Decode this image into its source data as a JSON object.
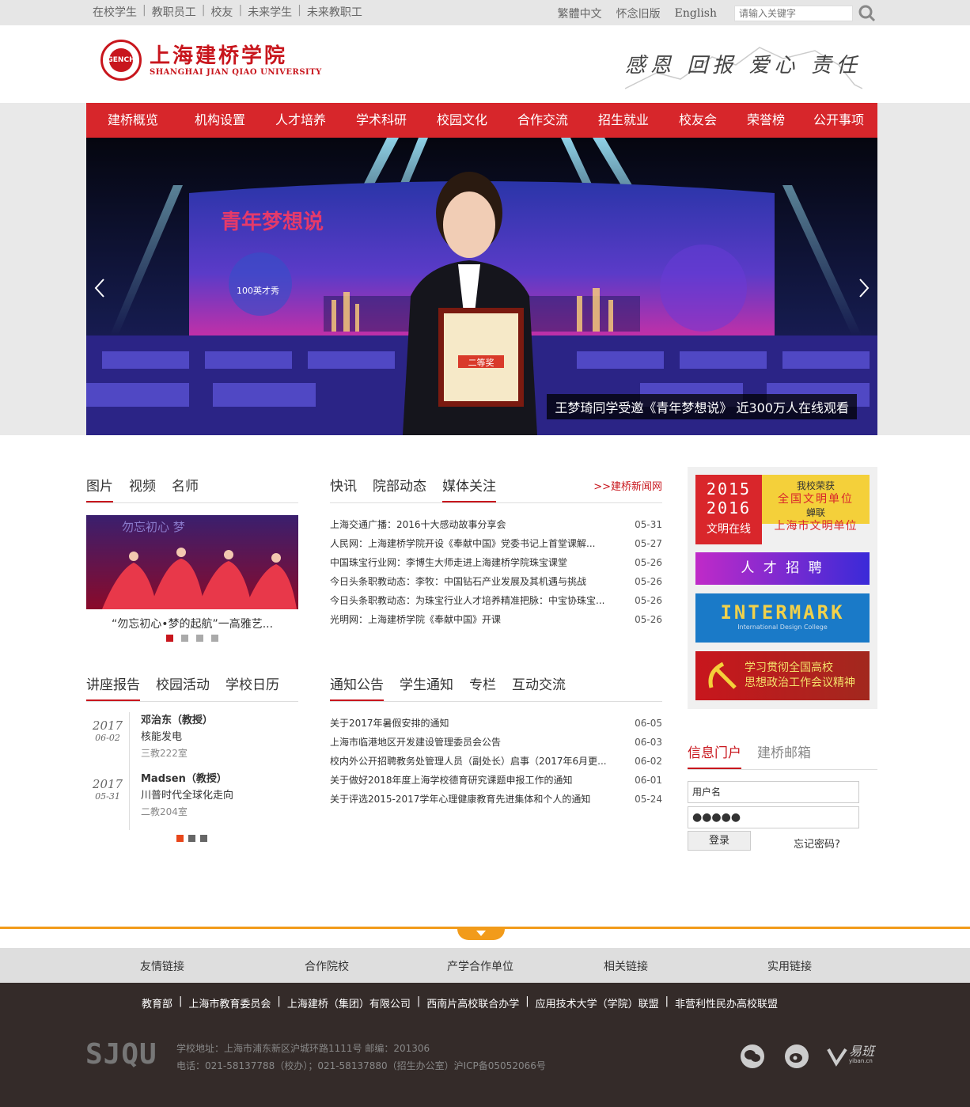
{
  "topbar": {
    "links": [
      "在校学生",
      "教职员工",
      "校友",
      "未来学生",
      "未来教职工"
    ],
    "right_links": [
      "繁體中文",
      "怀念旧版"
    ],
    "english": "English",
    "search_placeholder": "请输入关键字"
  },
  "header": {
    "logo_seal": "GENCH",
    "logo_cn": "上海建桥学院",
    "logo_en": "SHANGHAI JIAN QIAO UNIVERSITY",
    "slogan": "感恩 回报 爱心 责任"
  },
  "nav": [
    "建桥概览",
    "机构设置",
    "人才培养",
    "学术科研",
    "校园文化",
    "合作交流",
    "招生就业",
    "校友会",
    "荣誉榜",
    "公开事项"
  ],
  "banner": {
    "caption": "王梦琦同学受邀《青年梦想说》 近300万人在线观看",
    "stage_title": "青年梦想说",
    "stage_sub": "100英才秀",
    "certificate": "二等奖"
  },
  "photo_section": {
    "tabs": [
      "图片",
      "视频",
      "名师"
    ],
    "caption": "“勿忘初心•梦的起航”一高雅艺...",
    "image_text": "勿忘初心 梦",
    "dots": 4
  },
  "news_section": {
    "tabs": [
      "快讯",
      "院部动态",
      "媒体关注"
    ],
    "more": ">>建桥新闻网",
    "items": [
      {
        "title": "上海交通广播：2016十大感动故事分享会",
        "date": "05-31"
      },
      {
        "title": "人民网：上海建桥学院开设《奉献中国》党委书记上首堂课解...",
        "date": "05-27"
      },
      {
        "title": "中国珠宝行业网：李博生大师走进上海建桥学院珠宝课堂",
        "date": "05-26"
      },
      {
        "title": "今日头条职教动态：李牧：中国钻石产业发展及其机遇与挑战",
        "date": "05-26"
      },
      {
        "title": "今日头条职教动态：为珠宝行业人才培养精准把脉：中宝协珠宝...",
        "date": "05-26"
      },
      {
        "title": "光明网：上海建桥学院《奉献中国》开课",
        "date": "05-26"
      }
    ]
  },
  "lecture_section": {
    "tabs": [
      "讲座报告",
      "校园活动",
      "学校日历"
    ],
    "items": [
      {
        "year": "2017",
        "md": "06-02",
        "name": "邓治东（教授）",
        "topic": "核能发电",
        "room": "三教222室"
      },
      {
        "year": "2017",
        "md": "05-31",
        "name": "Madsen（教授）",
        "topic": "川普时代全球化走向",
        "room": "二教204室"
      }
    ]
  },
  "notice_section": {
    "tabs": [
      "通知公告",
      "学生通知",
      "专栏",
      "互动交流"
    ],
    "items": [
      {
        "title": "关于2017年暑假安排的通知",
        "date": "06-05"
      },
      {
        "title": "上海市临港地区开发建设管理委员会公告",
        "date": "06-03"
      },
      {
        "title": "校内外公开招聘教务处管理人员（副处长）启事（2017年6月更...",
        "date": "06-02"
      },
      {
        "title": "关于做好2018年度上海学校德育研究课题申报工作的通知",
        "date": "06-01"
      },
      {
        "title": "关于评选2015-2017学年心理健康教育先进集体和个人的通知",
        "date": "05-24"
      }
    ]
  },
  "promos": {
    "civil_years": [
      "2015",
      "2016"
    ],
    "civil_left": "文明在线",
    "civil_lines": [
      "我校荣获",
      "全国文明单位",
      "蝉联",
      "上海市文明单位"
    ],
    "recruit": "人 才 招 聘",
    "intermark": "INTERMARK",
    "intermark_sub": "International Design College",
    "party": [
      "学习贯彻全国高校",
      "思想政治工作会议精神"
    ]
  },
  "portal": {
    "tabs": [
      "信息门户",
      "建桥邮箱"
    ],
    "username": "用户名",
    "password": "●●●●●",
    "login": "登录",
    "forgot": "忘记密码?"
  },
  "footer": {
    "links": [
      "友情链接",
      "合作院校",
      "产学合作单位",
      "相关链接",
      "实用链接"
    ],
    "partners": [
      "教育部",
      "上海市教育委员会",
      "上海建桥（集团）有限公司",
      "西南片高校联合办学",
      "应用技术大学（学院）联盟",
      "非营利性民办高校联盟"
    ],
    "brand": "SJQU",
    "address": "学校地址：上海市浦东新区沪城环路1111号 邮编：201306",
    "phone": "电话：021-58137788（校办）；021-58137880（招生办公室）沪ICP备05052066号",
    "yiban": "易班",
    "yiban_url": "yiban.cn"
  }
}
